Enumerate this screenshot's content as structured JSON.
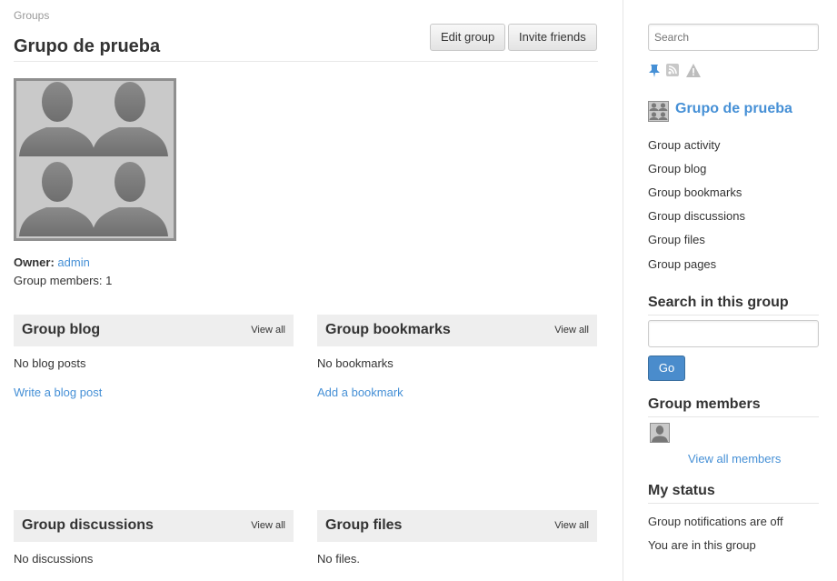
{
  "breadcrumb": "Groups",
  "title": "Grupo de prueba",
  "buttons": {
    "edit": "Edit group",
    "invite": "Invite friends"
  },
  "owner": {
    "label": "Owner:",
    "name": "admin"
  },
  "members_count": "Group members: 1",
  "modules": [
    {
      "title": "Group blog",
      "view_all": "View all",
      "empty": "No blog posts",
      "add": "Write a blog post"
    },
    {
      "title": "Group bookmarks",
      "view_all": "View all",
      "empty": "No bookmarks",
      "add": "Add a bookmark"
    },
    {
      "title": "Group discussions",
      "view_all": "View all",
      "empty": "No discussions"
    },
    {
      "title": "Group files",
      "view_all": "View all",
      "empty": "No files."
    }
  ],
  "sidebar": {
    "search_placeholder": "Search",
    "icons": [
      "pin-icon",
      "rss-icon",
      "report-icon"
    ],
    "group_name": "Grupo de prueba",
    "menu": [
      "Group activity",
      "Group blog",
      "Group bookmarks",
      "Group discussions",
      "Group files",
      "Group pages"
    ],
    "search_heading": "Search in this group",
    "go_label": "Go",
    "members_heading": "Group members",
    "view_all_members": "View all members",
    "status_heading": "My status",
    "status_lines": [
      "Group notifications are off",
      "You are in this group"
    ]
  },
  "colors": {
    "link": "#4690d6",
    "module_header_bg": "#eeeeee",
    "go_button": "#4a8ccc"
  }
}
